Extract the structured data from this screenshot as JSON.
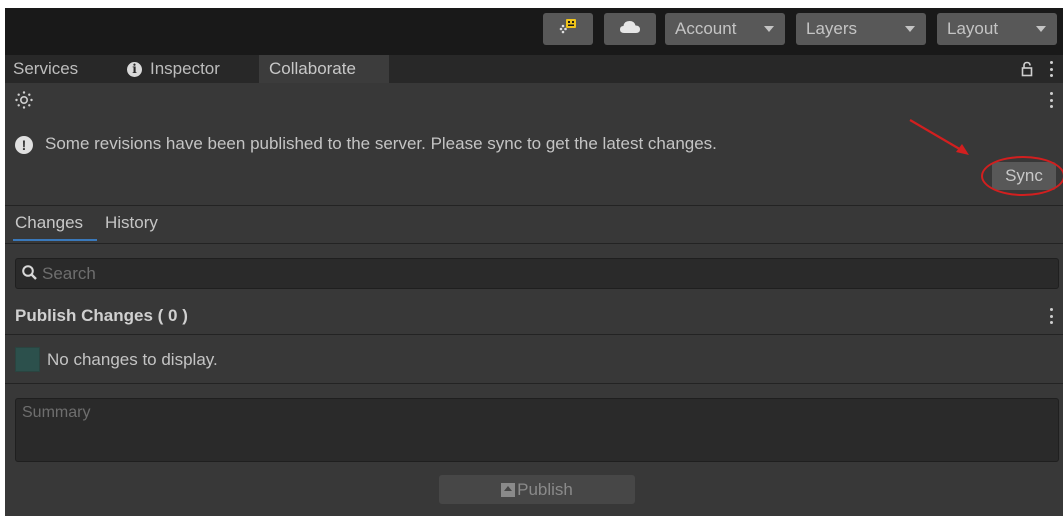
{
  "toolbar": {
    "account_label": "Account",
    "layers_label": "Layers",
    "layout_label": "Layout",
    "collab_icon": "collaborate-icon",
    "cloud_icon": "cloud-icon"
  },
  "tabs": {
    "services": "Services",
    "inspector": "Inspector",
    "collaborate": "Collaborate"
  },
  "notice": {
    "text": "Some revisions have been published to the server. Please sync to get the latest changes.",
    "sync_label": "Sync"
  },
  "view_tabs": {
    "changes": "Changes",
    "history": "History"
  },
  "search": {
    "placeholder": "Search"
  },
  "publish": {
    "header": "Publish Changes ( 0 )",
    "empty_text": "No changes to display.",
    "summary_placeholder": "Summary",
    "button_label": "Publish"
  },
  "colors": {
    "accent": "#3a79bb",
    "highlight": "#d21f1f",
    "collab_badge": "#f0c419"
  }
}
